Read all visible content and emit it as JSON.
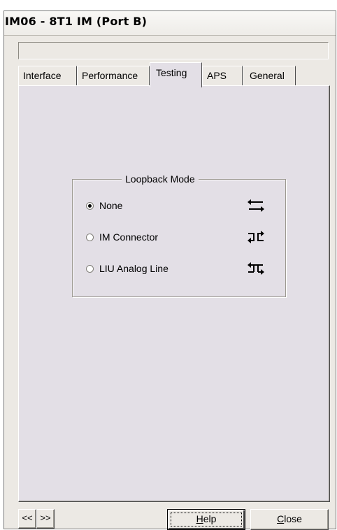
{
  "window": {
    "title": "IM06 - 8T1 IM (Port B)"
  },
  "status_field": {
    "value": ""
  },
  "tabs": [
    {
      "label": "Interface",
      "active": false
    },
    {
      "label": "Performance",
      "active": false
    },
    {
      "label": "Testing",
      "active": true
    },
    {
      "label": "APS",
      "active": false
    },
    {
      "label": "General",
      "active": false
    }
  ],
  "loopback": {
    "legend": "Loopback Mode",
    "options": [
      {
        "label": "None",
        "checked": true,
        "icon": "loopback-none-icon"
      },
      {
        "label": "IM Connector",
        "checked": false,
        "icon": "loopback-connector-icon"
      },
      {
        "label": "LIU Analog Line",
        "checked": false,
        "icon": "loopback-line-icon"
      }
    ]
  },
  "footer": {
    "prev_label": "<<",
    "next_label": ">>",
    "help_first": "H",
    "help_rest": "elp",
    "close_first": "C",
    "close_rest": "lose"
  }
}
